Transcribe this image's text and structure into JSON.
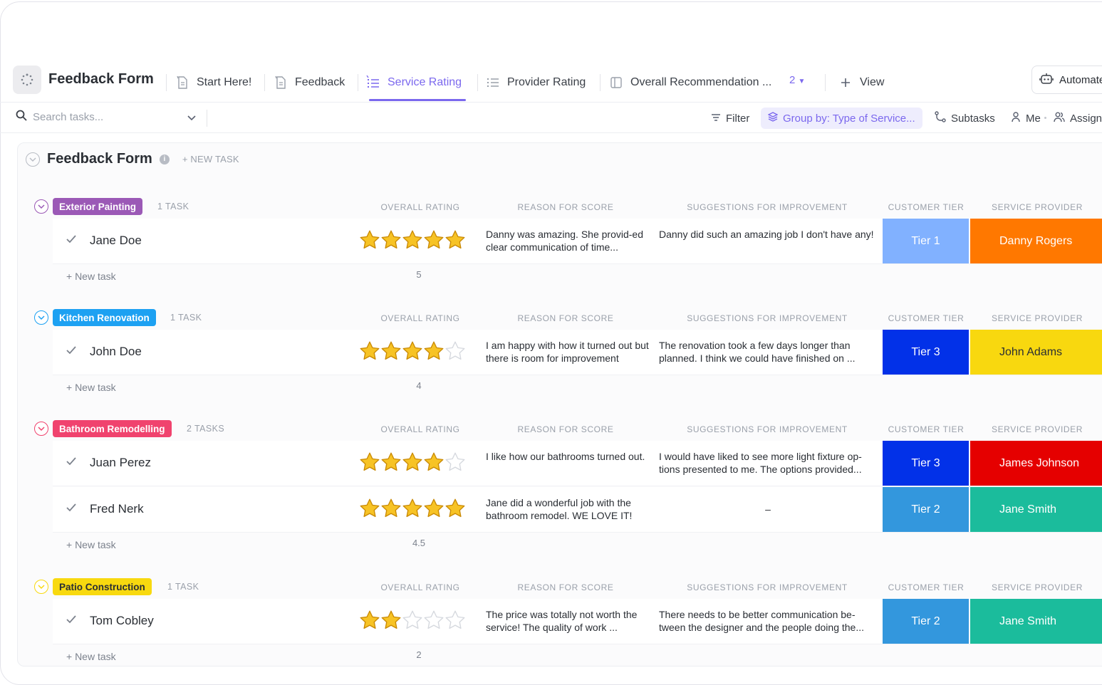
{
  "app": {
    "title": "Feedback Form"
  },
  "tabs": [
    {
      "label": "Start Here!",
      "icon": "doc-icon"
    },
    {
      "label": "Feedback",
      "icon": "doc-icon"
    },
    {
      "label": "Service Rating",
      "icon": "list-icon",
      "active": true
    },
    {
      "label": "Provider Rating",
      "icon": "list-icon"
    },
    {
      "label": "Overall Recommendation ...",
      "icon": "board-icon"
    }
  ],
  "more_tabs": "2",
  "add_view": "View",
  "automate": "Automate",
  "toolbar": {
    "search_placeholder": "Search tasks...",
    "filter": "Filter",
    "group_by": "Group by: Type of Service...",
    "subtasks": "Subtasks",
    "me": "Me",
    "assign": "Assign"
  },
  "list": {
    "title": "Feedback Form",
    "new_task": "+ NEW TASK"
  },
  "columns": {
    "rating": "OVERALL RATING",
    "reason": "REASON FOR SCORE",
    "suggestions": "SUGGESTIONS FOR IMPROVEMENT",
    "tier": "CUSTOMER TIER",
    "provider": "SERVICE PROVIDER"
  },
  "new_task_row": "+ New task",
  "colors": {
    "accent": "#7b68ee",
    "exterior": "#9b59b6",
    "kitchen": "#1da1f2",
    "bathroom": "#f0436e",
    "patio": "#f8d90f",
    "tier1": "#81b1ff",
    "tier2": "#3397dd",
    "tier3": "#0231e8",
    "orange": "#ff7800",
    "yellow": "#f8d80f",
    "red": "#e50000",
    "teal": "#1bbc9c"
  },
  "groups": [
    {
      "label": "Exterior Painting",
      "count": "1 TASK",
      "color": "#9b59b6",
      "text_color": "#ffffff",
      "average": "5",
      "tasks": [
        {
          "name": "Jane Doe",
          "rating": 5,
          "reason": "Danny was amazing. She provid-ed clear communication of time...",
          "suggestion": "Danny did such an amazing job I don't have any!",
          "tier": "Tier 1",
          "tier_color": "#81b1ff",
          "provider": "Danny Rogers",
          "provider_color": "#ff7800",
          "provider_text": "#ffffff"
        }
      ]
    },
    {
      "label": "Kitchen Renovation",
      "count": "1 TASK",
      "color": "#1da1f2",
      "text_color": "#ffffff",
      "average": "4",
      "tasks": [
        {
          "name": "John Doe",
          "rating": 4,
          "reason": "I am happy with how it turned out but there is room for improvement",
          "suggestion": "The renovation took a few days longer than planned. I think we could have finished on ...",
          "tier": "Tier 3",
          "tier_color": "#0231e8",
          "provider": "John Adams",
          "provider_color": "#f8d80f",
          "provider_text": "#2a2e34"
        }
      ]
    },
    {
      "label": "Bathroom Remodelling",
      "count": "2 TASKS",
      "color": "#f0436e",
      "text_color": "#ffffff",
      "average": "4.5",
      "tasks": [
        {
          "name": "Juan Perez",
          "rating": 4,
          "reason": "I like how our bathrooms turned out.",
          "suggestion": "I would have liked to see more light fixture op-tions presented to me. The options provided...",
          "tier": "Tier 3",
          "tier_color": "#0231e8",
          "provider": "James Johnson",
          "provider_color": "#e50000",
          "provider_text": "#ffffff"
        },
        {
          "name": "Fred Nerk",
          "rating": 5,
          "reason": "Jane did a wonderful job with the bathroom remodel. WE LOVE IT!",
          "suggestion": "–",
          "tier": "Tier 2",
          "tier_color": "#3397dd",
          "provider": "Jane Smith",
          "provider_color": "#1bbc9c",
          "provider_text": "#ffffff"
        }
      ]
    },
    {
      "label": "Patio Construction",
      "count": "1 TASK",
      "color": "#f8d90f",
      "text_color": "#2a2e34",
      "average": "2",
      "tasks": [
        {
          "name": "Tom Cobley",
          "rating": 2,
          "reason": "The price was totally not worth the service! The quality of work ...",
          "suggestion": "There needs to be better communication be-tween the designer and the people doing the...",
          "tier": "Tier 2",
          "tier_color": "#3397dd",
          "provider": "Jane Smith",
          "provider_color": "#1bbc9c",
          "provider_text": "#ffffff"
        }
      ]
    }
  ]
}
